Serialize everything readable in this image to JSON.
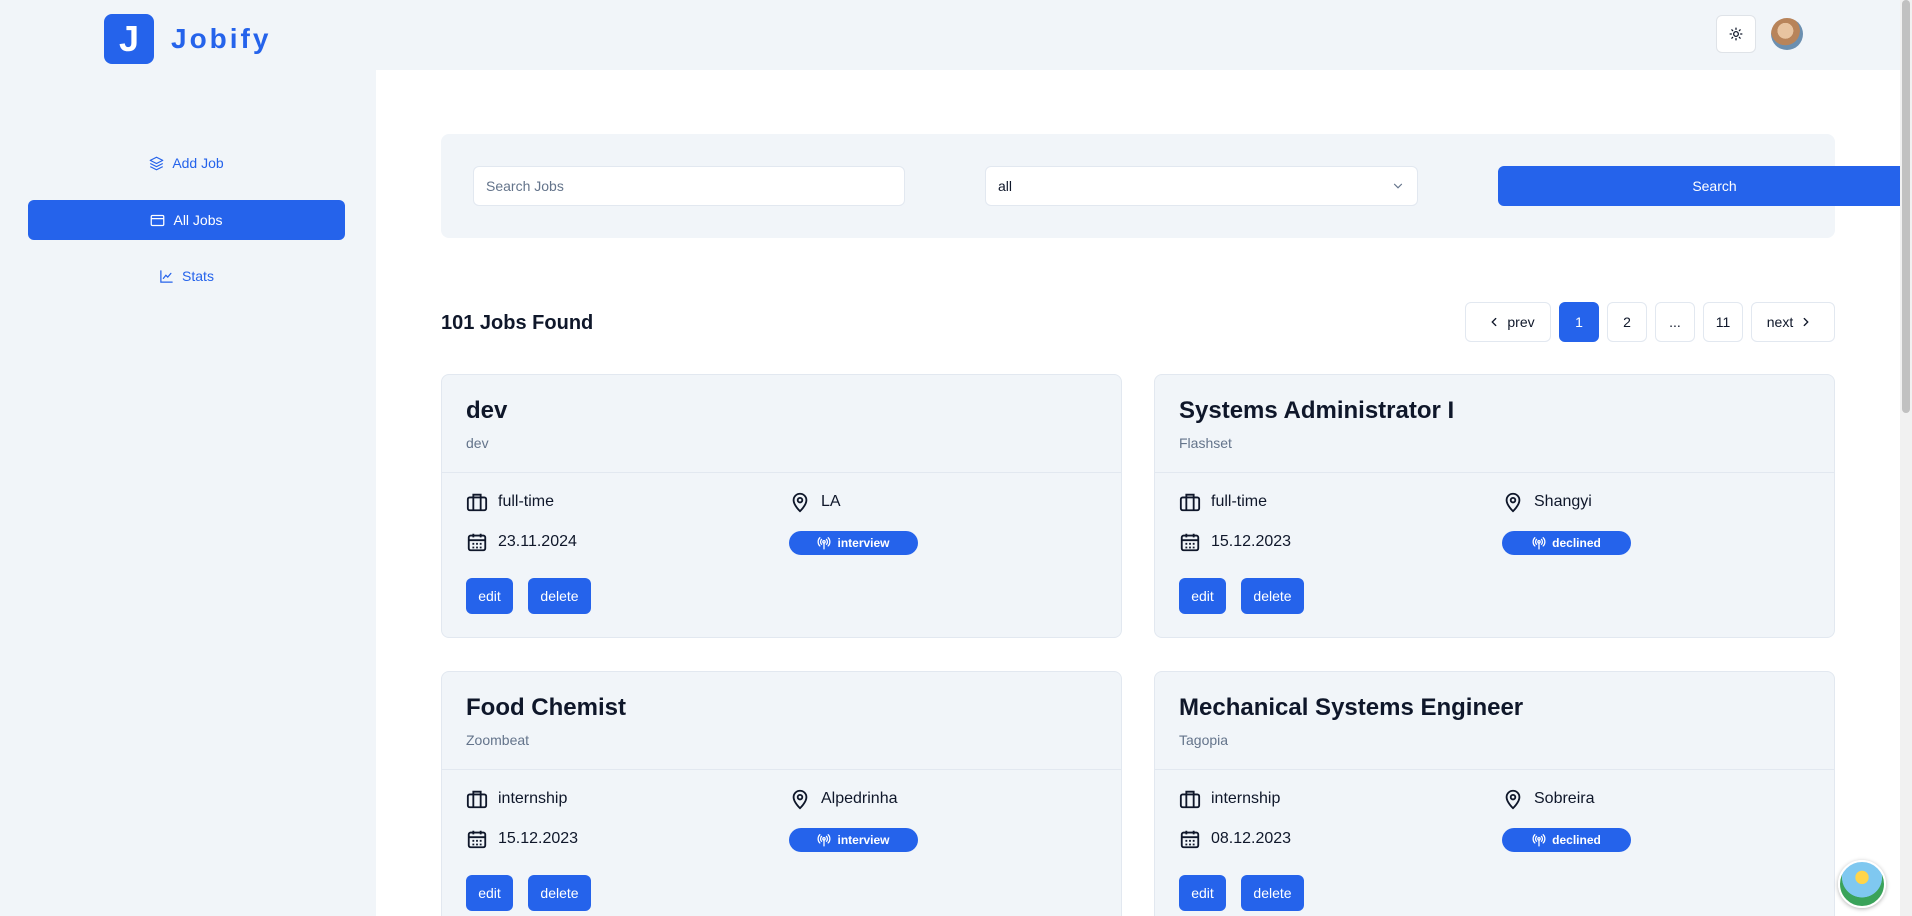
{
  "header": {
    "logo_letter": "J",
    "app_name": "Jobify",
    "theme_icon": "sun-icon"
  },
  "sidebar": {
    "items": [
      {
        "label": "Add Job",
        "icon": "layers-icon"
      },
      {
        "label": "All Jobs",
        "icon": "window-icon",
        "active": true
      },
      {
        "label": "Stats",
        "icon": "chart-icon"
      }
    ]
  },
  "search": {
    "placeholder": "Search Jobs",
    "status_value": "all",
    "button_label": "Search"
  },
  "results": {
    "count_label": "101 Jobs Found"
  },
  "pagination": {
    "prev_label": "prev",
    "pages": [
      "1",
      "2",
      "...",
      "11"
    ],
    "current": "1",
    "next_label": "next"
  },
  "jobs": [
    {
      "position": "dev",
      "company": "dev",
      "type": "full-time",
      "location": "LA",
      "date": "23.11.2024",
      "status": "interview"
    },
    {
      "position": "Systems Administrator I",
      "company": "Flashset",
      "type": "full-time",
      "location": "Shangyi",
      "date": "15.12.2023",
      "status": "declined"
    },
    {
      "position": "Food Chemist",
      "company": "Zoombeat",
      "type": "internship",
      "location": "Alpedrinha",
      "date": "15.12.2023",
      "status": "interview"
    },
    {
      "position": "Mechanical Systems Engineer",
      "company": "Tagopia",
      "type": "internship",
      "location": "Sobreira",
      "date": "08.12.2023",
      "status": "declined"
    }
  ],
  "card_actions": {
    "edit_label": "edit",
    "delete_label": "delete"
  },
  "colors": {
    "primary": "#2563eb",
    "background": "#f1f5f9",
    "muted_text": "#64748b"
  }
}
